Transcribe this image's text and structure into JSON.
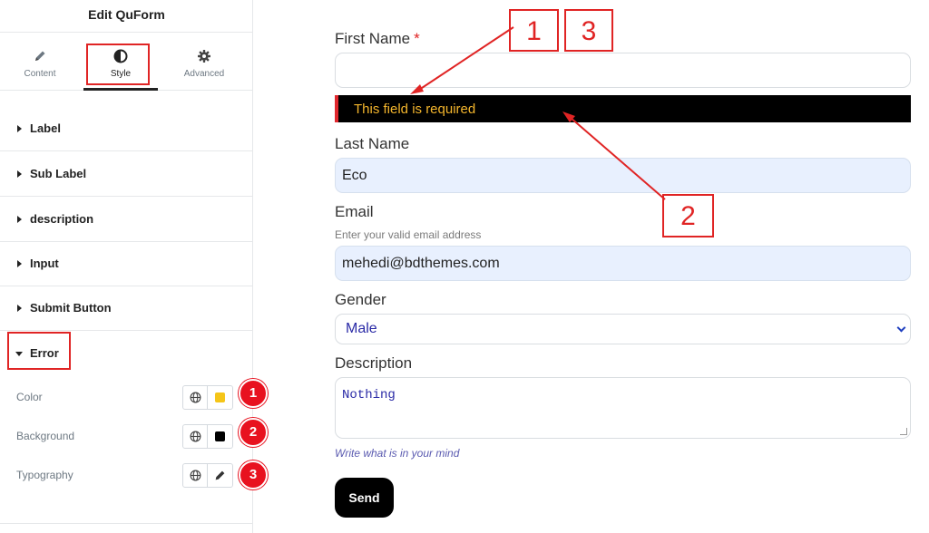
{
  "panel": {
    "title": "Edit QuForm",
    "tabs": [
      {
        "label": "Content",
        "icon": "pencil-icon"
      },
      {
        "label": "Style",
        "icon": "half-circle-icon"
      },
      {
        "label": "Advanced",
        "icon": "gear-icon"
      }
    ],
    "active_tab": "Style",
    "sections": [
      "Label",
      "Sub Label",
      "description",
      "Input",
      "Submit Button",
      "Error"
    ],
    "open_section": "Error",
    "error_controls": [
      {
        "label": "Color",
        "swatch": "#f5c518",
        "marker": "1"
      },
      {
        "label": "Background",
        "swatch": "#000000",
        "marker": "2"
      },
      {
        "label": "Typography",
        "marker": "3"
      }
    ]
  },
  "form": {
    "first_name_label": "First Name",
    "required_mark": "*",
    "first_name_value": "",
    "error_message": "This field is required",
    "last_name_label": "Last Name",
    "last_name_value": "Eco",
    "email_label": "Email",
    "email_hint": "Enter your valid email address",
    "email_value": "mehedi@bdthemes.com",
    "gender_label": "Gender",
    "gender_value": "Male",
    "description_label": "Description",
    "description_value": "Nothing",
    "description_hint": "Write what is in your mind",
    "send_label": "Send"
  },
  "callouts": {
    "one": "1",
    "two": "2",
    "three": "3"
  },
  "colors": {
    "accent_red": "#e02424",
    "error_text": "#f3b52c",
    "error_bg": "#000000",
    "autofill_bg": "#e8f0fe"
  }
}
